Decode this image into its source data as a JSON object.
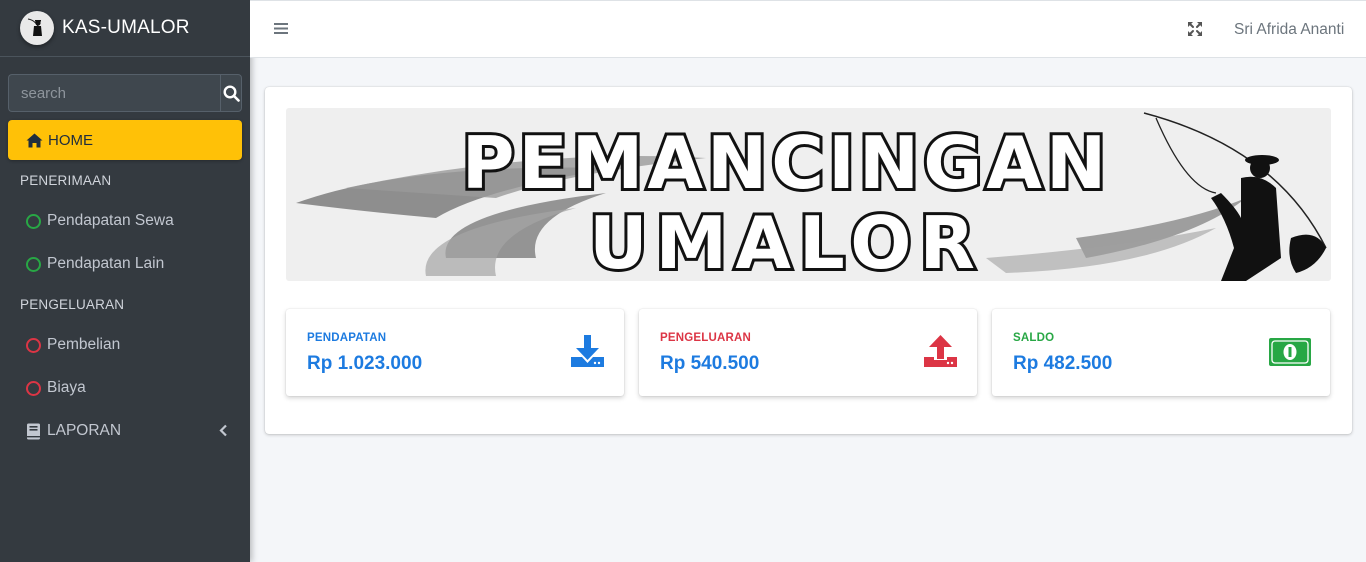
{
  "brand": {
    "title": "KAS-UMALOR"
  },
  "search": {
    "placeholder": "search"
  },
  "sidebar": {
    "home_label": "HOME",
    "sections": [
      {
        "header": "PENERIMAAN",
        "items": [
          {
            "label": "Pendapatan Sewa",
            "icon": "circle-outline-icon",
            "color": "#28a745"
          },
          {
            "label": "Pendapatan Lain",
            "icon": "circle-outline-icon",
            "color": "#28a745"
          }
        ]
      },
      {
        "header": "PENGELUARAN",
        "items": [
          {
            "label": "Pembelian",
            "icon": "circle-outline-icon",
            "color": "#dc3545"
          },
          {
            "label": "Biaya",
            "icon": "circle-outline-icon",
            "color": "#dc3545"
          }
        ]
      }
    ],
    "laporan_label": "LAPORAN"
  },
  "topbar": {
    "username": "Sri Afrida Ananti"
  },
  "banner": {
    "line1": "PEMANCINGAN",
    "line2": "UMALOR"
  },
  "stats": [
    {
      "label": "PENDAPATAN",
      "value": "Rp 1.023.000",
      "label_color": "#1d7be0",
      "icon": "download-icon"
    },
    {
      "label": "PENGELUARAN",
      "value": "Rp 540.500",
      "label_color": "#dc3545",
      "icon": "upload-icon"
    },
    {
      "label": "SALDO",
      "value": "Rp 482.500",
      "label_color": "#28a745",
      "icon": "money-bill-icon"
    }
  ],
  "colors": {
    "sidebar": "#343a40",
    "accent": "#ffc107",
    "primary": "#1d7be0",
    "danger": "#dc3545",
    "success": "#28a745"
  }
}
